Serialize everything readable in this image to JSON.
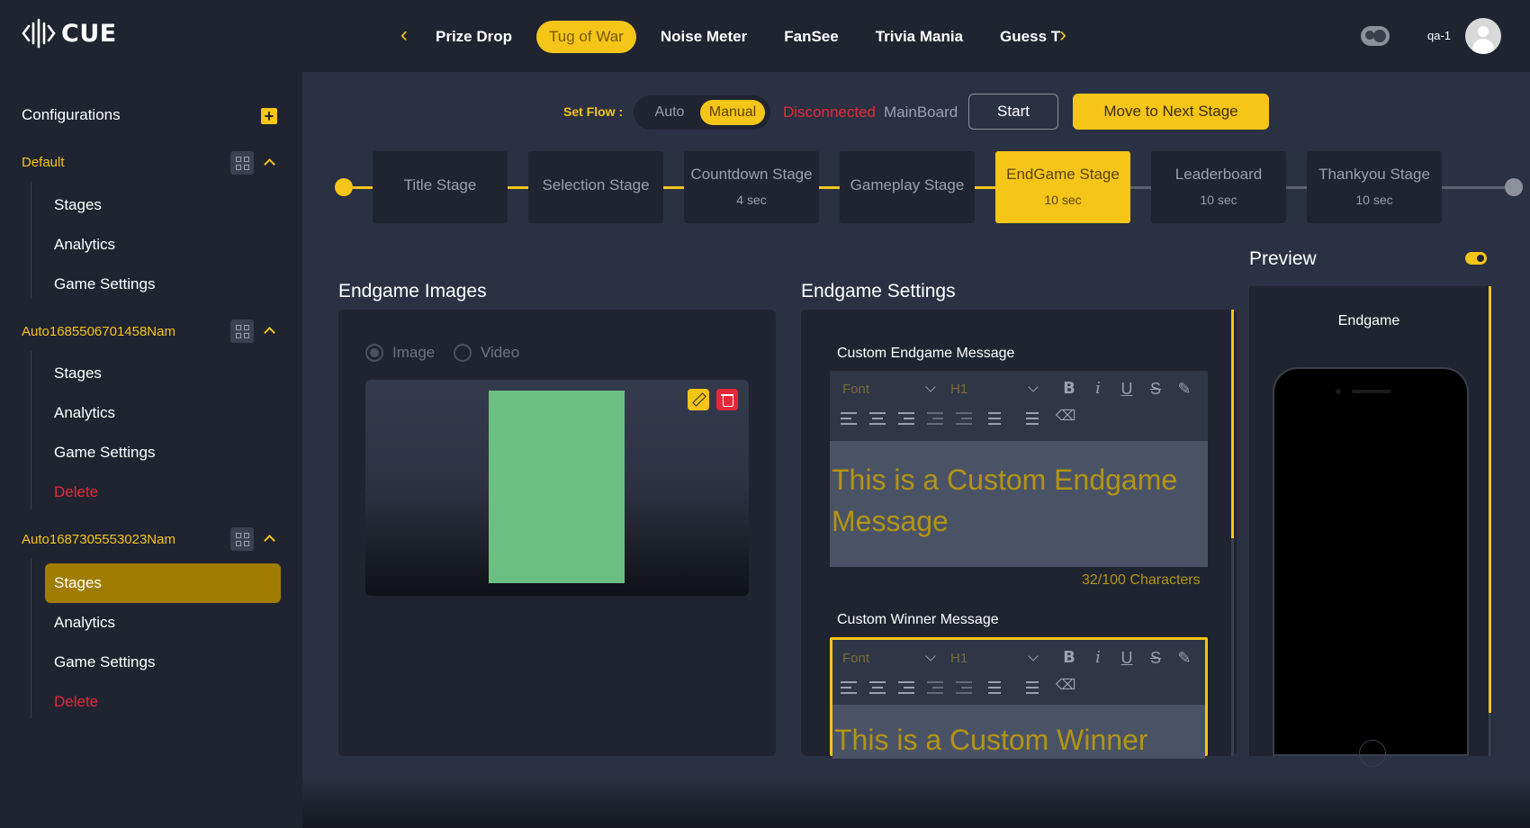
{
  "app": {
    "logo_text": "CUE"
  },
  "game_tabs": [
    {
      "label": "Prize Drop",
      "active": false
    },
    {
      "label": "Tug of War",
      "active": true
    },
    {
      "label": "Noise Meter",
      "active": false
    },
    {
      "label": "FanSee",
      "active": false
    },
    {
      "label": "Trivia Mania",
      "active": false
    },
    {
      "label": "Guess T",
      "active": false
    }
  ],
  "user": {
    "name": "qa-1"
  },
  "sidebar": {
    "heading": "Configurations",
    "configs": [
      {
        "name": "Default",
        "items": [
          "Stages",
          "Analytics",
          "Game Settings"
        ]
      },
      {
        "name": "Auto1685506701458Nam",
        "items": [
          "Stages",
          "Analytics",
          "Game Settings",
          "Delete"
        ]
      },
      {
        "name": "Auto1687305553023Nam",
        "items": [
          "Stages",
          "Analytics",
          "Game Settings",
          "Delete"
        ],
        "active_item": "Stages"
      }
    ]
  },
  "flow": {
    "label": "Set Flow :",
    "options": [
      "Auto",
      "Manual"
    ],
    "selected": "Manual",
    "connection_status": "Disconnected",
    "board_name": "MainBoard",
    "start_label": "Start",
    "next_stage_label": "Move to Next Stage"
  },
  "stages": [
    {
      "name": "Title Stage",
      "duration": ""
    },
    {
      "name": "Selection Stage",
      "duration": ""
    },
    {
      "name": "Countdown Stage",
      "duration": "4 sec"
    },
    {
      "name": "Gameplay Stage",
      "duration": ""
    },
    {
      "name": "EndGame Stage",
      "duration": "10 sec",
      "active": true
    },
    {
      "name": "Leaderboard",
      "duration": "10 sec"
    },
    {
      "name": "Thankyou Stage",
      "duration": "10 sec"
    }
  ],
  "endgame_images": {
    "title": "Endgame Images",
    "media_options": [
      "Image",
      "Video"
    ],
    "media_selected": "Image"
  },
  "endgame_settings": {
    "title": "Endgame Settings",
    "toolbar": {
      "font_placeholder": "Font",
      "heading_value": "H1"
    },
    "custom_message": {
      "label": "Custom Endgame Message",
      "value": "This is a Custom Endgame Message",
      "char_count": "32/100 Characters"
    },
    "winner_message": {
      "label": "Custom Winner Message",
      "value": "This is a Custom Winner"
    }
  },
  "preview": {
    "title": "Preview",
    "screen_title": "Endgame",
    "enabled": true
  },
  "colors": {
    "accent": "#f5c518",
    "danger": "#e8283a",
    "bg": "#1f2430",
    "panel": "#2a3142"
  }
}
